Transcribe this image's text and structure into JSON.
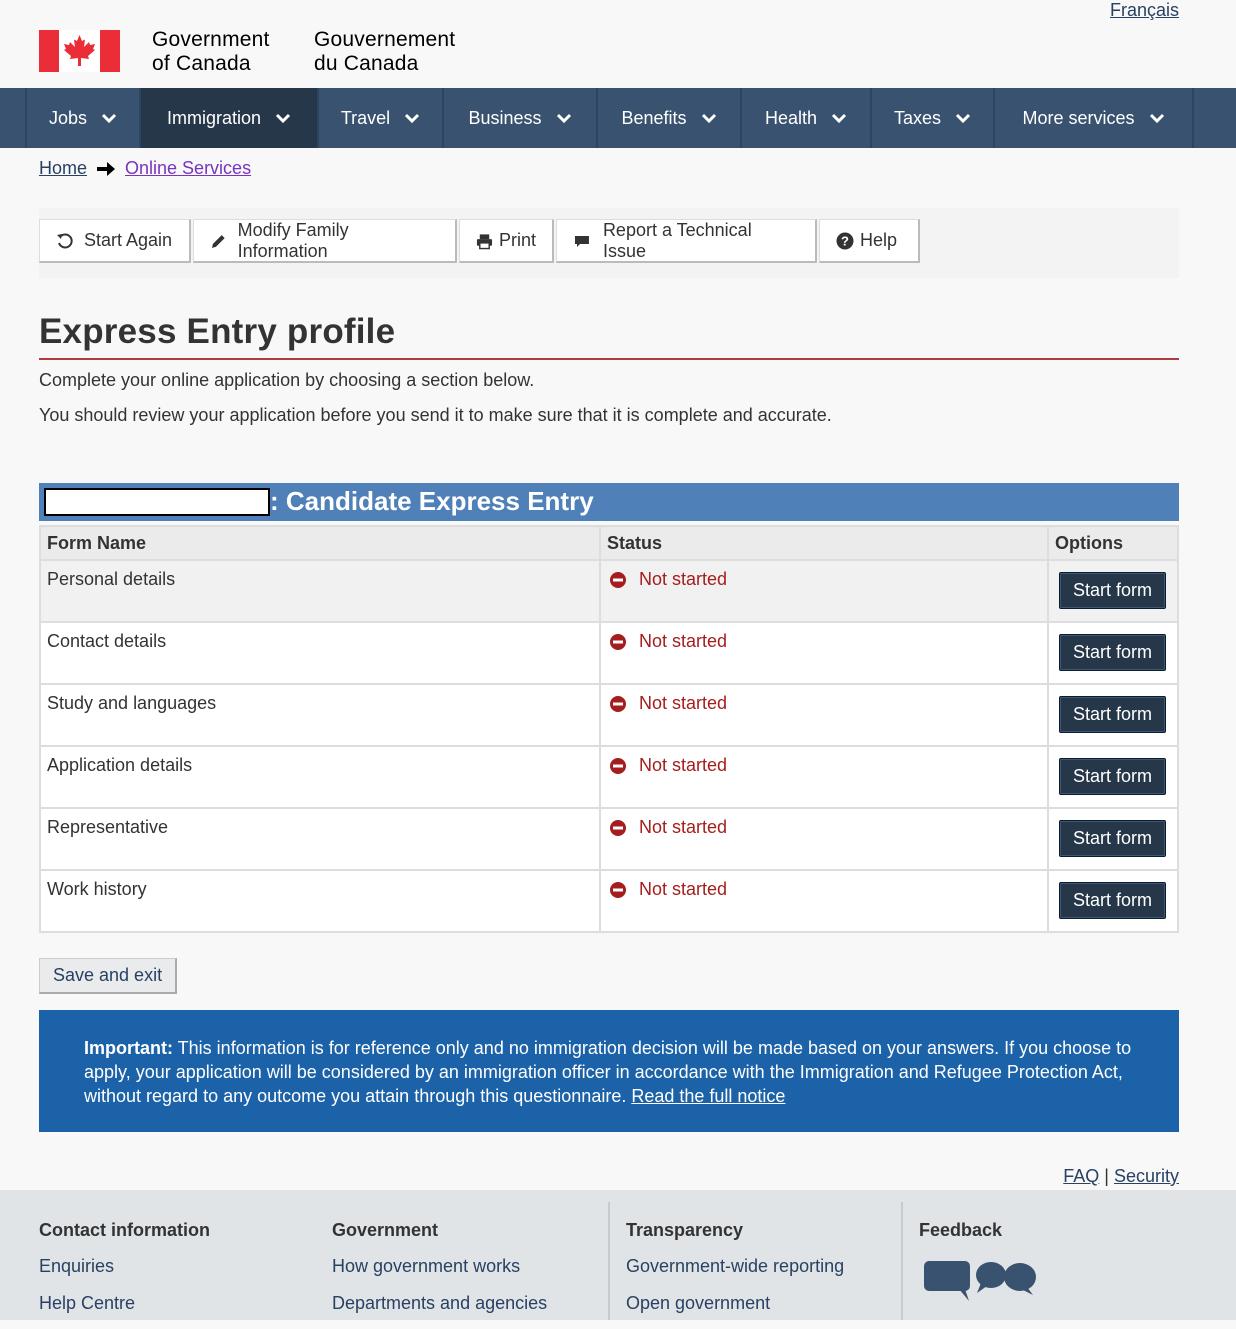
{
  "header": {
    "language_link": "Français",
    "brand_en_line1": "Government",
    "brand_en_line2": "of Canada",
    "brand_fr_line1": "Gouvernement",
    "brand_fr_line2": "du Canada",
    "flag_color": "#ea2d37"
  },
  "menu": {
    "items": [
      "Jobs",
      "Immigration",
      "Travel",
      "Business",
      "Benefits",
      "Health",
      "Taxes",
      "More services"
    ],
    "active": "Immigration"
  },
  "breadcrumb": {
    "home": "Home",
    "current": "Online Services"
  },
  "toolbar": {
    "start_again": "Start Again",
    "modify_family": "Modify Family Information",
    "print": "Print",
    "report_issue": "Report a Technical Issue",
    "help": "Help"
  },
  "page": {
    "title": "Express Entry profile",
    "lead1": "Complete your online application by choosing a section below.",
    "lead2": "You should review your application before you send it to make sure that it is complete and accurate."
  },
  "panel": {
    "title": ": Candidate Express Entry"
  },
  "table": {
    "headers": [
      "Form Name",
      "Status",
      "Options"
    ],
    "rows": [
      {
        "form": "Personal details",
        "status": "Not started",
        "action": "Start form"
      },
      {
        "form": "Contact details",
        "status": "Not started",
        "action": "Start form"
      },
      {
        "form": "Study and languages",
        "status": "Not started",
        "action": "Start form"
      },
      {
        "form": "Application details",
        "status": "Not started",
        "action": "Start form"
      },
      {
        "form": "Representative",
        "status": "Not started",
        "action": "Start form"
      },
      {
        "form": "Work history",
        "status": "Not started",
        "action": "Start form"
      }
    ]
  },
  "actions": {
    "save_exit": "Save and exit"
  },
  "notice": {
    "label": "Important:",
    "text": " This information is for reference only and no immigration decision will be made based on your answers. If you choose to apply, your application will be considered by an immigration officer in accordance with the Immigration and Refugee Protection Act, without regard to any outcome you attain through this questionnaire. ",
    "link": "Read the full notice"
  },
  "footer_links": {
    "faq": "FAQ",
    "separator": " | ",
    "security": "Security"
  },
  "footer": {
    "contact_heading": "Contact information",
    "contact_links": [
      "Enquiries",
      "Help Centre"
    ],
    "government_heading": "Government",
    "government_links": [
      "How government works",
      "Departments and agencies"
    ],
    "transparency_heading": "Transparency",
    "transparency_links": [
      "Government-wide reporting",
      "Open government"
    ],
    "feedback_heading": "Feedback"
  },
  "colors": {
    "menu_bg": "#38526f",
    "menu_active": "#26374a",
    "panel_heading": "#4f80b8",
    "status_red": "#a51d1d",
    "notice_bg": "#1c62a8",
    "title_rule": "#af3c43"
  }
}
